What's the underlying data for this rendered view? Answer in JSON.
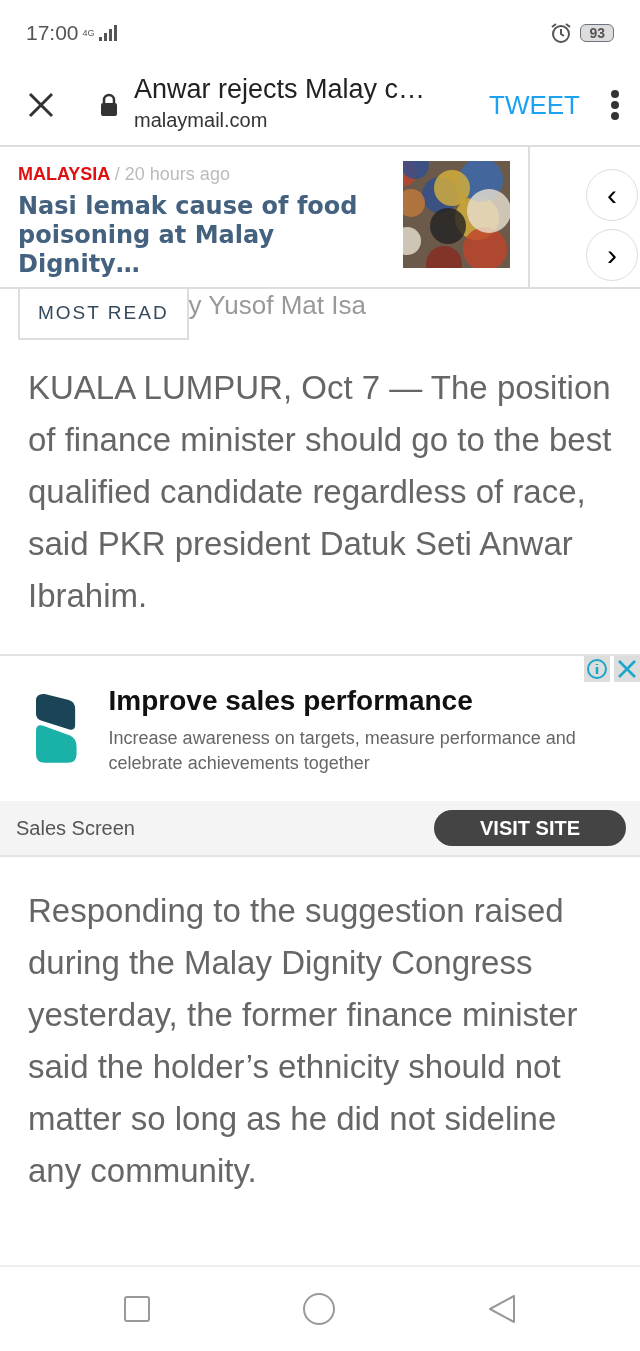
{
  "status_bar": {
    "time": "17:00",
    "network": "4G",
    "battery": "93"
  },
  "toolbar": {
    "title": "Anwar rejects Malay c…",
    "url": "malaymail.com",
    "action": "TWEET"
  },
  "carousel": {
    "items": [
      {
        "category": "MALAYSIA",
        "time": "/ 20 hours ago",
        "headline": "Nasi lemak cause of food poisoning at Malay Dignity…"
      }
    ],
    "prev": "‹",
    "next": "›"
  },
  "most_read_tab": "MOST READ",
  "byline": "y Yusof Mat Isa",
  "paragraphs": [
    "KUALA LUMPUR, Oct 7 — The position of finance minister should go to the best qualified candidate regardless of race, said PKR president Datuk Seti Anwar Ibrahim."
  ],
  "ad": {
    "headline": "Improve sales performance",
    "body": "Increase awareness on targets, measure performance and celebrate achievements together",
    "advertiser": "Sales Screen",
    "button": "VISIT SITE"
  },
  "paragraphs_after_ad": [
    "Responding to the suggestion raised during the Malay Dignity Congress yesterday, the former finance minister said the holder’s ethnicity should not matter so long as he did not sideline any community."
  ]
}
